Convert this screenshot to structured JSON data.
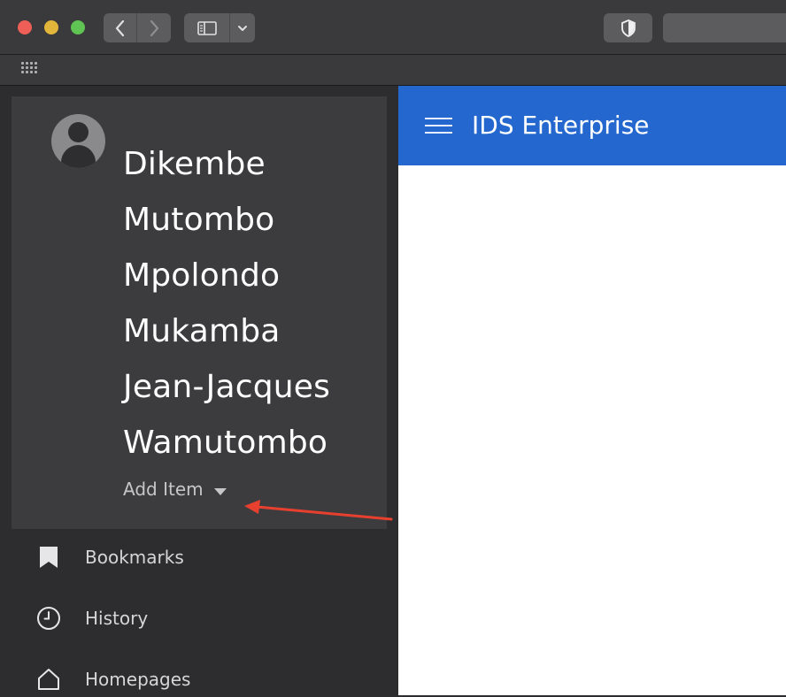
{
  "browser": {
    "icons": {
      "back": "chevron-left-icon",
      "forward": "chevron-right-icon",
      "sidebar": "sidebar-icon",
      "menu": "chevron-down-icon",
      "privacy": "shield-icon",
      "favorites": "grid-icon"
    }
  },
  "sidebar": {
    "user": {
      "name_lines": [
        "Dikembe",
        "Mutombo",
        "Mpolondo",
        "Mukamba",
        "Jean-Jacques",
        "Wamutombo"
      ],
      "add_item_label": "Add Item"
    },
    "items": [
      {
        "label": "Bookmarks",
        "icon": "bookmark-icon"
      },
      {
        "label": "History",
        "icon": "clock-icon"
      },
      {
        "label": "Homepages",
        "icon": "home-icon"
      }
    ]
  },
  "header": {
    "title": "IDS Enterprise",
    "color": "#2468cf"
  },
  "annotation": {
    "arrow_color": "#e8402f"
  }
}
